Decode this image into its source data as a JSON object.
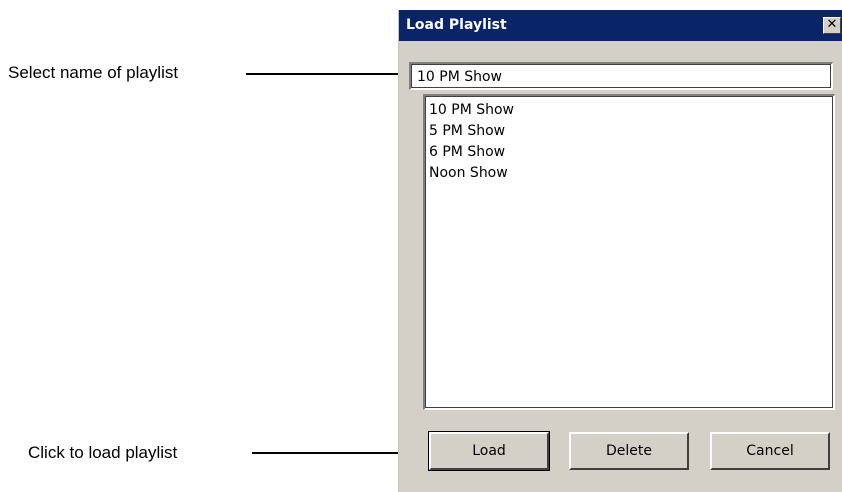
{
  "annotations": {
    "select_name": "Select name of playlist",
    "click_load": "Click to load playlist"
  },
  "dialog": {
    "title": "Load Playlist",
    "close_label": "✕",
    "name_field": {
      "value": "10 PM Show"
    },
    "playlists": [
      "10 PM Show",
      "5 PM Show",
      "6 PM Show",
      "Noon Show"
    ],
    "buttons": {
      "load": "Load",
      "delete": "Delete",
      "cancel": "Cancel"
    }
  },
  "colors": {
    "titlebar": "#0a246a",
    "dialog_face": "#d4d0c8",
    "field_background": "#ffffff"
  }
}
